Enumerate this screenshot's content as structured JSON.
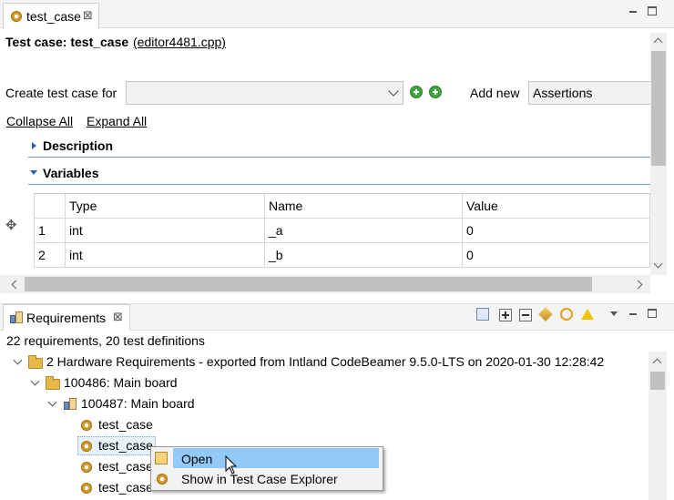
{
  "editor": {
    "tab_label": "test_case",
    "tab_close": "⊠",
    "header_title": "Test case: test_case",
    "header_link": "(editor4481.cpp)",
    "create_label": "Create test case for",
    "create_value": "",
    "add_new_label": "Add new",
    "add_new_value": "Assertions",
    "collapse_all": "Collapse All",
    "expand_all": "Expand All",
    "sections": [
      {
        "label": "Description",
        "expanded": false
      },
      {
        "label": "Variables",
        "expanded": true
      }
    ],
    "variables": {
      "columns": [
        "Type",
        "Name",
        "Value"
      ],
      "rows": [
        {
          "num": "1",
          "type": "int",
          "name": "_a",
          "value": "0"
        },
        {
          "num": "2",
          "type": "int",
          "name": "_b",
          "value": "0"
        }
      ]
    }
  },
  "requirements": {
    "tab_label": "Requirements",
    "tab_close": "⊠",
    "summary": "22 requirements, 20 test definitions",
    "tree": {
      "root": "2 Hardware Requirements - exported from Intland CodeBeamer 9.5.0-LTS on 2020-01-30 12:28:42",
      "level1": "100486: Main board",
      "level2": "100487: Main board",
      "leaves": [
        "test_case",
        "test_case",
        "test_case",
        "test_case"
      ]
    },
    "context_menu": {
      "items": [
        "Open",
        "Show in Test Case Explorer"
      ]
    }
  },
  "colors": {
    "accent": "#2563b8",
    "section_line": "#6b9fcf",
    "menu_highlight": "#91c9f7",
    "selection": "#e5f1fb"
  }
}
